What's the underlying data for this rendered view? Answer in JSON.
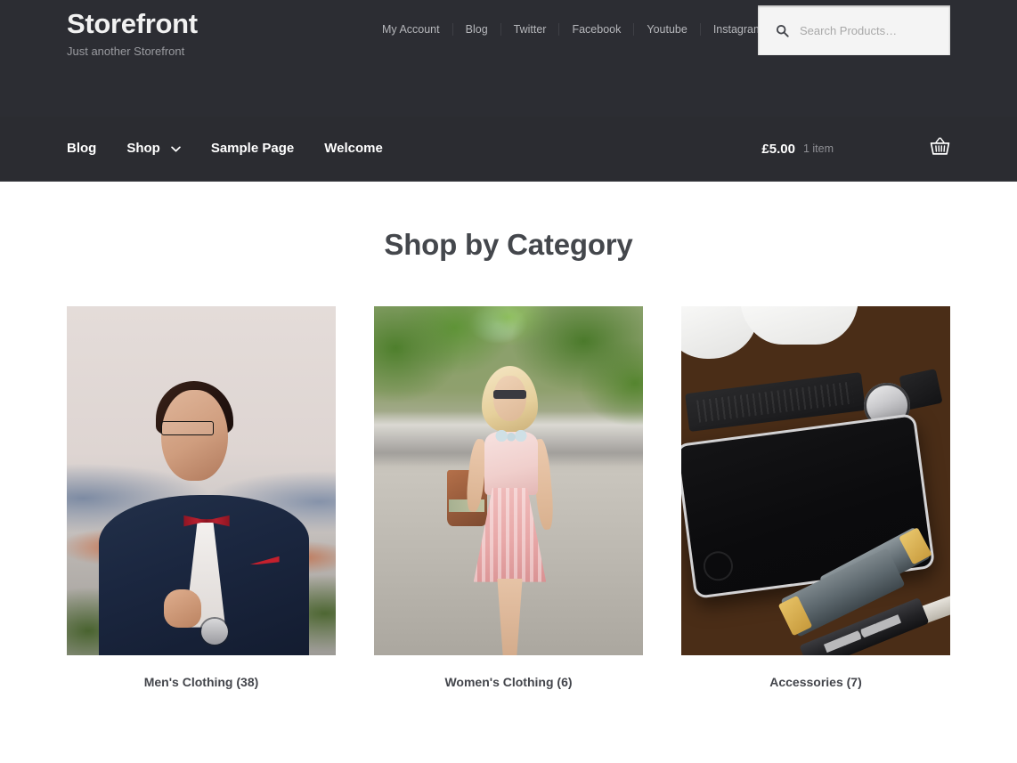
{
  "header": {
    "site_title": "Storefront",
    "site_description": "Just another Storefront",
    "secondary_nav": [
      {
        "label": "My Account"
      },
      {
        "label": "Blog"
      },
      {
        "label": "Twitter"
      },
      {
        "label": "Facebook"
      },
      {
        "label": "Youtube"
      },
      {
        "label": "Instagram"
      }
    ],
    "search": {
      "placeholder": "Search Products…",
      "value": "",
      "icon": "search-icon"
    },
    "background_color": "#2c2d33"
  },
  "main_nav": {
    "items": [
      {
        "label": "Blog",
        "has_dropdown": false
      },
      {
        "label": "Shop",
        "has_dropdown": true,
        "dropdown_icon": "chevron-down-icon"
      },
      {
        "label": "Sample Page",
        "has_dropdown": false
      },
      {
        "label": "Welcome",
        "has_dropdown": false
      }
    ],
    "cart": {
      "amount": "£5.00",
      "count": "1 item",
      "icon": "shopping-basket-icon"
    },
    "background_color": "#2b2c31"
  },
  "main": {
    "page_title": "Shop by Category",
    "title_color": "#44474c",
    "categories": [
      {
        "name": "Men's Clothing",
        "count": "(38)",
        "image": "man-in-navy-suit-with-red-bow-tie"
      },
      {
        "name": "Women's Clothing",
        "count": "(6)",
        "image": "woman-in-pink-dress-on-street"
      },
      {
        "name": "Accessories",
        "count": "(7)",
        "image": "phone-watch-sunglasses-on-wood"
      }
    ]
  }
}
